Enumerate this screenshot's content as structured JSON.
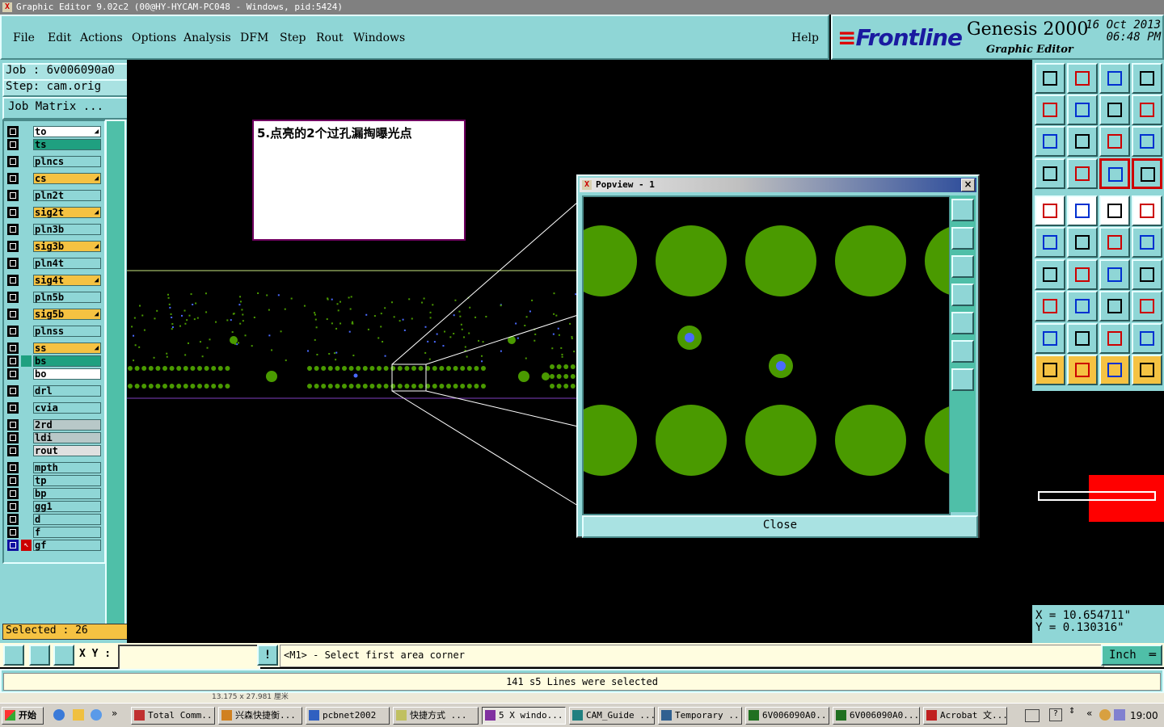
{
  "window": {
    "title": "Graphic Editor 9.02c2 (00@HY-HYCAM-PC048 - Windows, pid:5424)"
  },
  "menu": {
    "items": [
      "File",
      "Edit",
      "Actions",
      "Options",
      "Analysis",
      "DFM",
      "Step",
      "Rout",
      "Windows"
    ],
    "help": "Help"
  },
  "brand": {
    "logo": "Frontline",
    "product": "Genesis 2000",
    "subtitle": "Graphic Editor",
    "date": "16 Oct 2013",
    "time": "06:48 PM"
  },
  "job": {
    "job_label": "Job : 6v006090a0",
    "step_label": "Step: cam.orig",
    "matrix_button": "Job Matrix ..."
  },
  "layers": [
    {
      "name": "to",
      "color": "#ffffff",
      "arrow": true
    },
    {
      "name": "ts",
      "color": "#1fa080",
      "arrow": false
    },
    {
      "name": "plncs",
      "color": "#8fd6d6",
      "arrow": false
    },
    {
      "name": "cs",
      "color": "#f5c242",
      "arrow": true
    },
    {
      "name": "pln2t",
      "color": "#8fd6d6",
      "arrow": false
    },
    {
      "name": "sig2t",
      "color": "#f5c242",
      "arrow": true
    },
    {
      "name": "pln3b",
      "color": "#8fd6d6",
      "arrow": false
    },
    {
      "name": "sig3b",
      "color": "#f5c242",
      "arrow": true
    },
    {
      "name": "pln4t",
      "color": "#8fd6d6",
      "arrow": false
    },
    {
      "name": "sig4t",
      "color": "#f5c242",
      "arrow": true
    },
    {
      "name": "pln5b",
      "color": "#8fd6d6",
      "arrow": false
    },
    {
      "name": "sig5b",
      "color": "#f5c242",
      "arrow": true
    },
    {
      "name": "plnss",
      "color": "#8fd6d6",
      "arrow": false
    },
    {
      "name": "ss",
      "color": "#f5c242",
      "arrow": true
    },
    {
      "name": "bs",
      "color": "#1fa080",
      "arrow": false
    },
    {
      "name": "bo",
      "color": "#ffffff",
      "arrow": false
    },
    {
      "name": "drl",
      "color": "#8fd6d6",
      "arrow": false
    },
    {
      "name": "cvia",
      "color": "#8fd6d6",
      "arrow": false
    },
    {
      "name": "2rd",
      "color": "#b8c8c8",
      "arrow": false
    },
    {
      "name": "ldi",
      "color": "#b8c8c8",
      "arrow": false
    },
    {
      "name": "rout",
      "color": "#e0e0e0",
      "arrow": false
    },
    {
      "name": "mpth",
      "color": "#8fd6d6",
      "arrow": false
    },
    {
      "name": "tp",
      "color": "#8fd6d6",
      "arrow": false
    },
    {
      "name": "bp",
      "color": "#8fd6d6",
      "arrow": false
    },
    {
      "name": "gg1",
      "color": "#8fd6d6",
      "arrow": false
    },
    {
      "name": "d",
      "color": "#8fd6d6",
      "arrow": false
    },
    {
      "name": "f",
      "color": "#8fd6d6",
      "arrow": false
    },
    {
      "name": "gf",
      "color": "#8fd6d6",
      "arrow": false
    }
  ],
  "selected": "Selected : 26",
  "annotation": "5.点亮的2个过孔漏掏曝光点",
  "popview": {
    "title": "Popview - 1",
    "close_x": "×",
    "close_button": "Close"
  },
  "coords": {
    "x": "X = 10.654711\"",
    "y": "Y = 0.130316\""
  },
  "cmd": {
    "xy_label": "X Y :",
    "xy_value": "",
    "prompt": "<M1> - Select first area corner",
    "units": "Inch"
  },
  "status": "141 s5 Lines were selected",
  "hscroll_text": "13.175 x 27.981 厘米",
  "taskbar": {
    "start": "开始",
    "tasks": [
      "Total Comm...",
      "兴森快捷衡...",
      "pcbnet2002",
      "快捷方式 ...",
      "5 X windo...",
      "CAM_Guide ...",
      "Temporary ...",
      "6V006090A0...",
      "6V006090A0...",
      "Acrobat 文..."
    ],
    "clock": "19:00"
  },
  "colors": {
    "panel": "#8fd6d6",
    "accent_teal": "#4fbfa8",
    "pad_green": "#4a9a00",
    "via_blue": "#4a6aff",
    "highlight_yellow": "#f5c242"
  }
}
